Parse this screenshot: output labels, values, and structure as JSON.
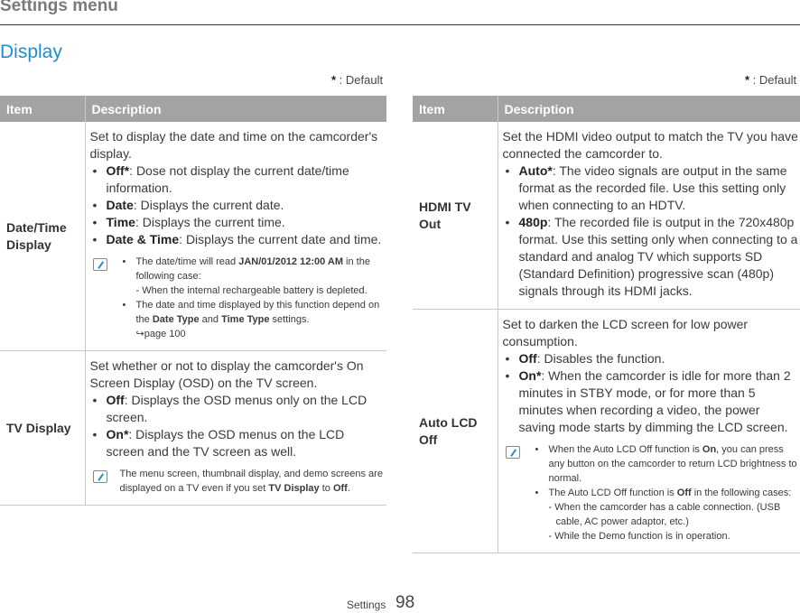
{
  "header": {
    "title": "Settings menu"
  },
  "section": {
    "title": "Display"
  },
  "default_note": {
    "mark": "*",
    "text": " : Default"
  },
  "table_headers": {
    "item": "Item",
    "description": "Description"
  },
  "left_table": {
    "rows": [
      {
        "item": "Date/Time Display",
        "intro": "Set to display the date and time on the camcorder's display.",
        "options": [
          {
            "name": "Off*",
            "text": ": Dose not display the current date/time information."
          },
          {
            "name": "Date",
            "text": ": Displays the current date."
          },
          {
            "name": "Time",
            "text": ": Displays the current time."
          },
          {
            "name": "Date & Time",
            "text": ": Displays the current date and time."
          }
        ],
        "note": {
          "b1_pre": "The date/time will read ",
          "b1_bold": "JAN/01/2012 12:00 AM",
          "b1_post": " in the following case:",
          "b1_sub": "- When the internal rechargeable battery is depleted.",
          "b2_pre": "The date and time displayed by this function depend on the ",
          "b2_bold1": "Date Type",
          "b2_mid": " and ",
          "b2_bold2": "Time Type",
          "b2_post": " settings.",
          "b2_ref": "↪page 100"
        }
      },
      {
        "item": "TV Display",
        "intro": "Set whether or not to display the camcorder's On Screen Display (OSD) on the TV screen.",
        "options": [
          {
            "name": "Off",
            "text": ": Displays the OSD menus only on the LCD screen."
          },
          {
            "name": "On*",
            "text": ": Displays the OSD menus on the LCD screen and the TV screen as well."
          }
        ],
        "note": {
          "pre": "The menu screen, thumbnail display, and demo screens are displayed on a TV even if you set ",
          "bold1": "TV Display",
          "mid": " to ",
          "bold2": "Off",
          "post": "."
        }
      }
    ]
  },
  "right_table": {
    "rows": [
      {
        "item": "HDMI TV Out",
        "intro": "Set the HDMI video output to match the TV you have connected the camcorder to.",
        "options": [
          {
            "name": "Auto*",
            "text": ": The video signals are output in the same format as the recorded file. Use this setting only when connecting to an HDTV."
          },
          {
            "name": "480p",
            "text": ": The recorded file is output in the 720x480p format. Use this setting only when connecting to a standard and analog TV which supports SD (Standard Definition) progressive scan (480p) signals through its HDMI jacks."
          }
        ]
      },
      {
        "item": "Auto LCD Off",
        "intro": "Set to darken the LCD screen for low power consumption.",
        "options": [
          {
            "name": "Off",
            "text": ": Disables the function."
          },
          {
            "name": "On*",
            "text": ": When the camcorder is idle for more than 2 minutes in STBY mode, or for more than 5 minutes when recording a video, the power saving mode starts by dimming the LCD screen."
          }
        ],
        "note": {
          "b1_pre": "When the Auto LCD Off function is ",
          "b1_bold": "On",
          "b1_post": ", you can press any button on the camcorder to return LCD brightness to normal.",
          "b2_pre": "The Auto LCD Off function is ",
          "b2_bold": "Off",
          "b2_post": " in the following cases:",
          "b2_sub1": "- When the camcorder has a cable connection. (USB",
          "b2_sub1b": "cable, AC power adaptor, etc.)",
          "b2_sub2": "- While the Demo function is in operation."
        }
      }
    ]
  },
  "footer": {
    "label": "Settings",
    "page": "98"
  }
}
